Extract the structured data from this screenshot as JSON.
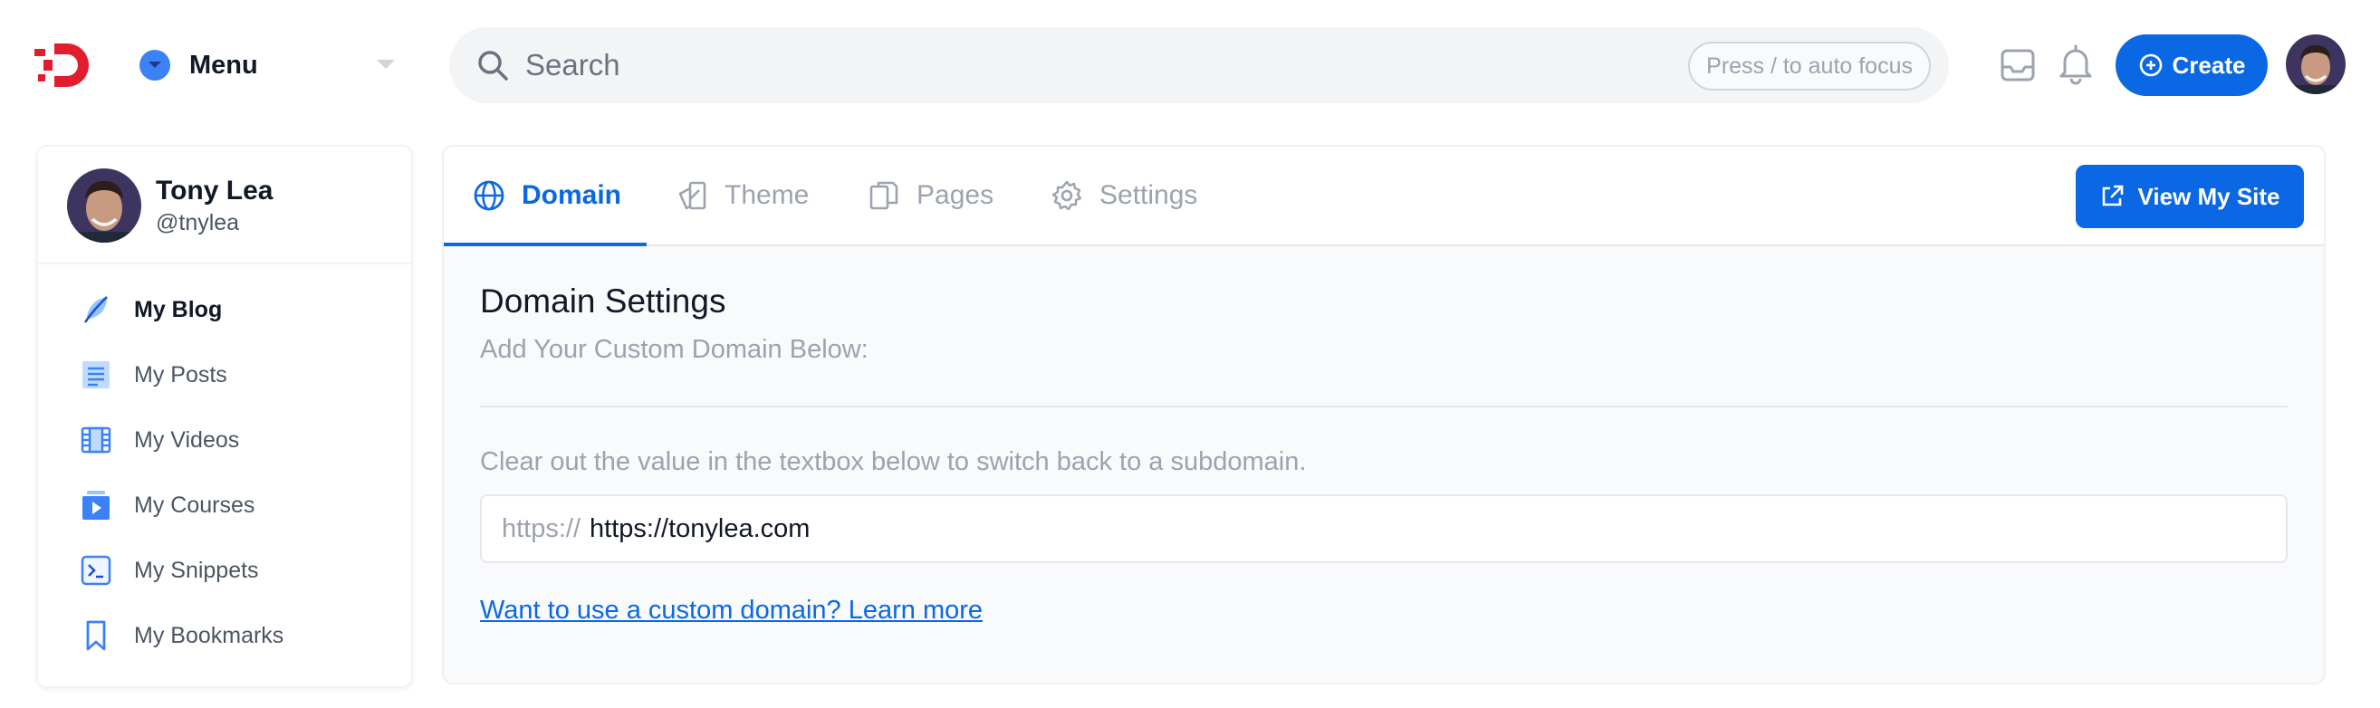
{
  "header": {
    "menu_label": "Menu",
    "search_placeholder": "Search",
    "search_hint": "Press / to auto focus",
    "create_label": "Create"
  },
  "sidebar": {
    "profile": {
      "name": "Tony Lea",
      "handle": "@tnylea"
    },
    "items": [
      {
        "label": "My Blog",
        "icon": "feather-icon",
        "active": true
      },
      {
        "label": "My Posts",
        "icon": "document-icon"
      },
      {
        "label": "My Videos",
        "icon": "film-icon"
      },
      {
        "label": "My Courses",
        "icon": "play-stack-icon"
      },
      {
        "label": "My Snippets",
        "icon": "terminal-icon"
      },
      {
        "label": "My Bookmarks",
        "icon": "bookmark-icon"
      }
    ]
  },
  "tabs": [
    {
      "label": "Domain",
      "icon": "globe-icon",
      "active": true
    },
    {
      "label": "Theme",
      "icon": "theme-icon"
    },
    {
      "label": "Pages",
      "icon": "pages-icon"
    },
    {
      "label": "Settings",
      "icon": "gear-icon"
    }
  ],
  "view_site_label": "View My Site",
  "domain": {
    "title": "Domain Settings",
    "subtitle": "Add Your Custom Domain Below:",
    "help": "Clear out the value in the textbox below to switch back to a subdomain.",
    "prefix": "https://",
    "value": "https://tonylea.com",
    "learn_more": "Want to use a custom domain? Learn more"
  },
  "colors": {
    "accent": "#0b68e4",
    "brand_red": "#e11d2e",
    "muted": "#9ca3af"
  }
}
